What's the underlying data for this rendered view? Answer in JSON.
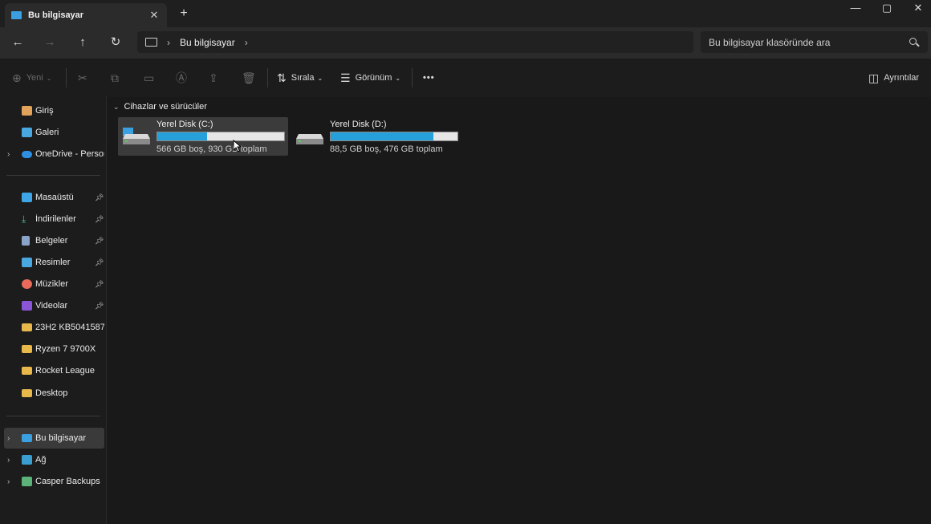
{
  "window": {
    "tab_title": "Bu bilgisayar",
    "tab_close": "✕",
    "new_tab": "+",
    "minimize": "—",
    "maximize": "▢",
    "close": "✕"
  },
  "nav": {
    "back": "←",
    "forward": "→",
    "up": "↑",
    "refresh": "↻",
    "breadcrumb": [
      "Bu bilgisayar"
    ],
    "search_placeholder": "Bu bilgisayar klasöründe ara"
  },
  "toolbar": {
    "new_label": "Yeni",
    "sort_label": "Sırala",
    "view_label": "Görünüm",
    "more": "•••",
    "details_label": "Ayrıntılar"
  },
  "sidebar": {
    "items": [
      {
        "label": "Giriş",
        "icon": "home-icon"
      },
      {
        "label": "Galeri",
        "icon": "gallery-icon"
      },
      {
        "label": "OneDrive - Persona",
        "icon": "cloud-icon"
      },
      {
        "label": "Masaüstü",
        "icon": "desktop-icon"
      },
      {
        "label": "İndirilenler",
        "icon": "download-icon"
      },
      {
        "label": "Belgeler",
        "icon": "documents-icon"
      },
      {
        "label": "Resimler",
        "icon": "pictures-icon"
      },
      {
        "label": "Müzikler",
        "icon": "music-icon"
      },
      {
        "label": "Videolar",
        "icon": "videos-icon"
      },
      {
        "label": "23H2 KB5041587",
        "icon": "folder-icon"
      },
      {
        "label": "Ryzen 7 9700X",
        "icon": "folder-icon"
      },
      {
        "label": "Rocket League",
        "icon": "folder-icon"
      },
      {
        "label": "Desktop",
        "icon": "folder-icon"
      },
      {
        "label": "Bu bilgisayar",
        "icon": "computer-icon"
      },
      {
        "label": "Ağ",
        "icon": "network-icon"
      },
      {
        "label": "Casper Backups",
        "icon": "backup-icon"
      }
    ]
  },
  "content": {
    "group_label": "Cihazlar ve sürücüler",
    "drives": [
      {
        "name": "Yerel Disk (C:)",
        "info": "566 GB boş, 930 GB toplam",
        "used_fraction": 0.39
      },
      {
        "name": "Yerel Disk (D:)",
        "info": "88,5 GB boş, 476 GB toplam",
        "used_fraction": 0.81
      }
    ]
  },
  "colors": {
    "accent": "#26a0da",
    "folder": "#e8b84a",
    "background": "#191919"
  }
}
